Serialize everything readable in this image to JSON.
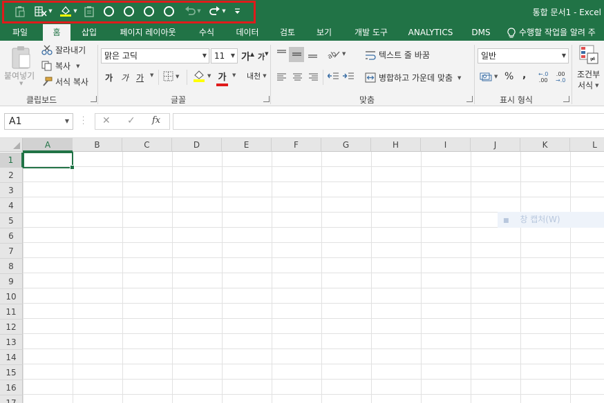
{
  "window": {
    "title": "통합 문서1 - Excel",
    "accent": "#217346",
    "highlight": "#e01b1b"
  },
  "qat": [
    "paste-special-icon",
    "format-cells-icon",
    "fill-color-icon",
    "clipboard-icon",
    "circle-icon",
    "circle-icon",
    "circle-icon",
    "circle-icon",
    "undo-icon",
    "redo-icon",
    "customize-icon"
  ],
  "tabs": [
    "파일",
    "홈",
    "삽입",
    "페이지 레이아웃",
    "수식",
    "데이터",
    "검토",
    "보기",
    "개발 도구",
    "ANALYTICS",
    "DMS",
    "수행할 작업을 알려 주"
  ],
  "ribbon": {
    "clipboard": {
      "paste": "붙여넣기",
      "cut": "잘라내기",
      "copy": "복사",
      "format_painter": "서식 복사",
      "label": "클립보드"
    },
    "font": {
      "name": "맑은 고딕",
      "size": "11",
      "grow": "가",
      "shrink": "가",
      "bold": "가",
      "italic": "가",
      "underline": "가",
      "font_color_glyph": "가",
      "phonetic": "내천",
      "label": "글꼴"
    },
    "alignment": {
      "wrap": "텍스트 줄 바꿈",
      "merge": "병합하고 가운데 맞춤",
      "label": "맞춤"
    },
    "number": {
      "format": "일반",
      "percent": "%",
      "comma": ",",
      "inc_decimal": ".00",
      "dec_decimal": ".00",
      "label": "표시 형식"
    },
    "conditional": {
      "line1": "조건부",
      "line2": "서식"
    }
  },
  "formula_bar": {
    "name_box": "A1",
    "fx": "fx",
    "cancel": "✕",
    "enter": "✓"
  },
  "columns": [
    "A",
    "B",
    "C",
    "D",
    "E",
    "F",
    "G",
    "H",
    "I",
    "J",
    "K",
    "L"
  ],
  "rows": [
    "1",
    "2",
    "3",
    "4",
    "5",
    "6",
    "7",
    "8",
    "9",
    "10",
    "11",
    "12",
    "13",
    "14",
    "15",
    "16",
    "17"
  ],
  "ghost_tip": "창 캡처(W)"
}
